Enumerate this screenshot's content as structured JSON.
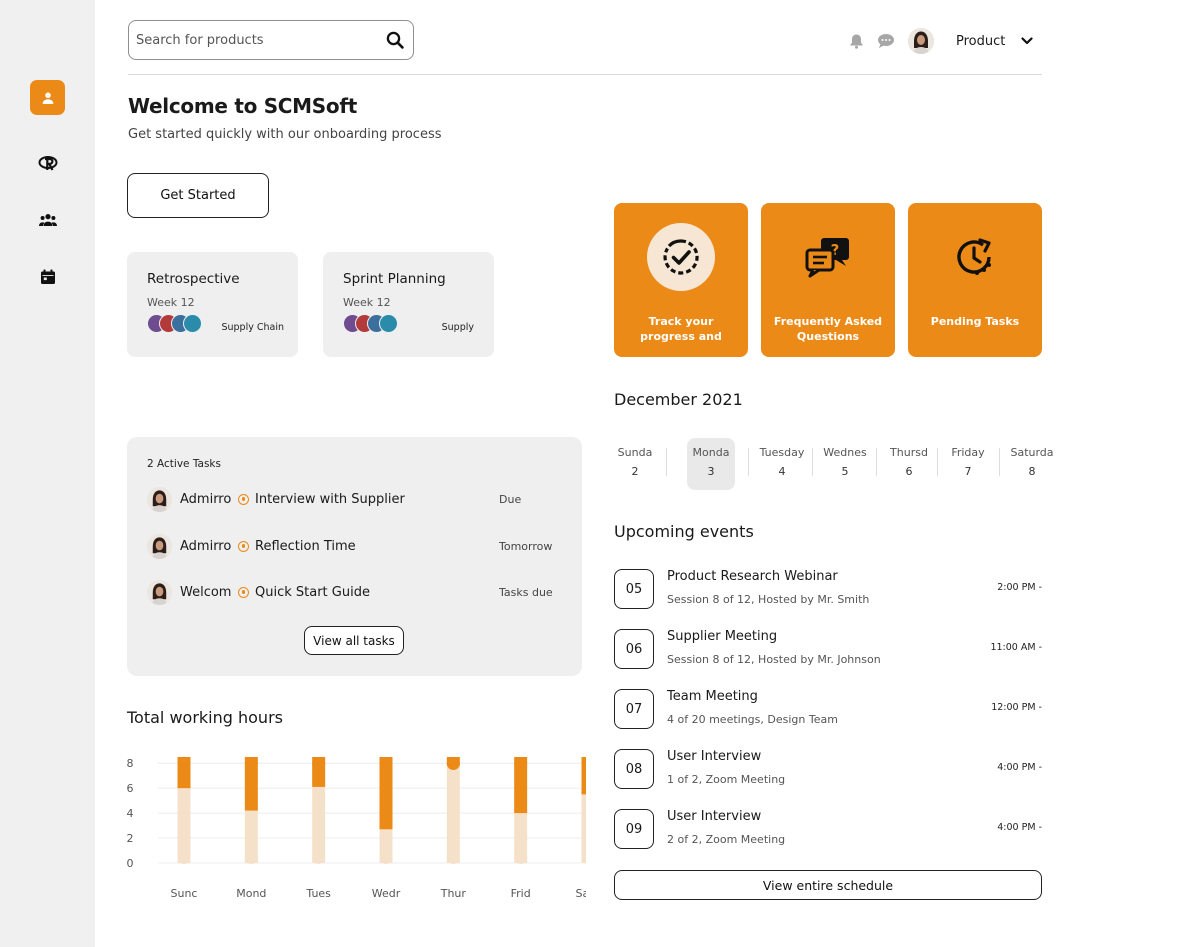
{
  "colors": {
    "accent": "#ec8a17",
    "accent_light": "#f5e1c9",
    "sidebar_bg": "#f0f0f0",
    "card_bg": "#efefef"
  },
  "sidebar": {
    "items": [
      {
        "icon": "user-icon",
        "active": true
      },
      {
        "icon": "r-logo-icon",
        "active": false
      },
      {
        "icon": "team-icon",
        "active": false
      },
      {
        "icon": "calendar-icon",
        "active": false
      }
    ]
  },
  "header": {
    "search_placeholder": "Search for products",
    "product_label": "Product"
  },
  "welcome": {
    "title": "Welcome to SCMSoft",
    "subtitle": "Get started quickly with our onboarding process",
    "button": "Get Started"
  },
  "meetings": [
    {
      "title": "Retrospective",
      "week": "Week 12",
      "tag": "Supply Chain"
    },
    {
      "title": "Sprint Planning",
      "week": "Week 12",
      "tag": "Supply"
    }
  ],
  "tasks": {
    "title": "2 Active Tasks",
    "items": [
      {
        "who": "Admirro",
        "name": "Interview with Supplier",
        "due": "Due"
      },
      {
        "who": "Admirro",
        "name": "Reflection Time",
        "due": "Tomorrow"
      },
      {
        "who": "Welcom",
        "name": "Quick Start Guide",
        "due": "Tasks due"
      }
    ],
    "button": "View all tasks"
  },
  "tiles": [
    {
      "icon": "progress-check-icon",
      "label": "Track your progress and"
    },
    {
      "icon": "faq-chat-icon",
      "label": "Frequently Asked Questions"
    },
    {
      "icon": "pending-clock-icon",
      "label": "Pending Tasks"
    }
  ],
  "calendar": {
    "month": "December 2021",
    "days": [
      {
        "name": "Sunda",
        "num": "2",
        "selected": false
      },
      {
        "name": "Monda",
        "num": "3",
        "selected": true
      },
      {
        "name": "Tuesday",
        "num": "4",
        "selected": false
      },
      {
        "name": "Wednes",
        "num": "5",
        "selected": false
      },
      {
        "name": "Thursd",
        "num": "6",
        "selected": false
      },
      {
        "name": "Friday",
        "num": "7",
        "selected": false
      },
      {
        "name": "Saturda",
        "num": "8",
        "selected": false
      }
    ]
  },
  "events": {
    "title": "Upcoming events",
    "items": [
      {
        "date": "05",
        "name": "Product Research Webinar",
        "desc": "Session 8 of 12, Hosted by Mr. Smith",
        "time": "2:00 PM -"
      },
      {
        "date": "06",
        "name": "Supplier Meeting",
        "desc": "Session 8 of 12, Hosted by Mr. Johnson",
        "time": "11:00 AM -"
      },
      {
        "date": "07",
        "name": "Team Meeting",
        "desc": "4 of 20 meetings, Design Team",
        "time": "12:00 PM -"
      },
      {
        "date": "08",
        "name": "User Interview",
        "desc": "1 of 2, Zoom Meeting",
        "time": "4:00 PM -"
      },
      {
        "date": "09",
        "name": "User Interview",
        "desc": "2 of 2, Zoom Meeting",
        "time": "4:00 PM -"
      }
    ],
    "button": "View entire schedule"
  },
  "chart_title": "Total working hours",
  "chart_data": {
    "type": "bar",
    "stacked": true,
    "categories": [
      "Sunc",
      "Mond",
      "Tues",
      "Wedr",
      "Thur",
      "Frid",
      "Satu"
    ],
    "ylim": [
      0,
      8.5
    ],
    "yticks": [
      0,
      2,
      4,
      6,
      8
    ],
    "grid": true,
    "series": [
      {
        "color": "#f5e1c9",
        "values": [
          6.0,
          4.2,
          6.1,
          2.7,
          7.8,
          4.0,
          5.5
        ]
      },
      {
        "color": "#ec8a17",
        "values": [
          2.5,
          4.3,
          2.4,
          5.8,
          0.7,
          4.5,
          3.0
        ]
      }
    ]
  }
}
